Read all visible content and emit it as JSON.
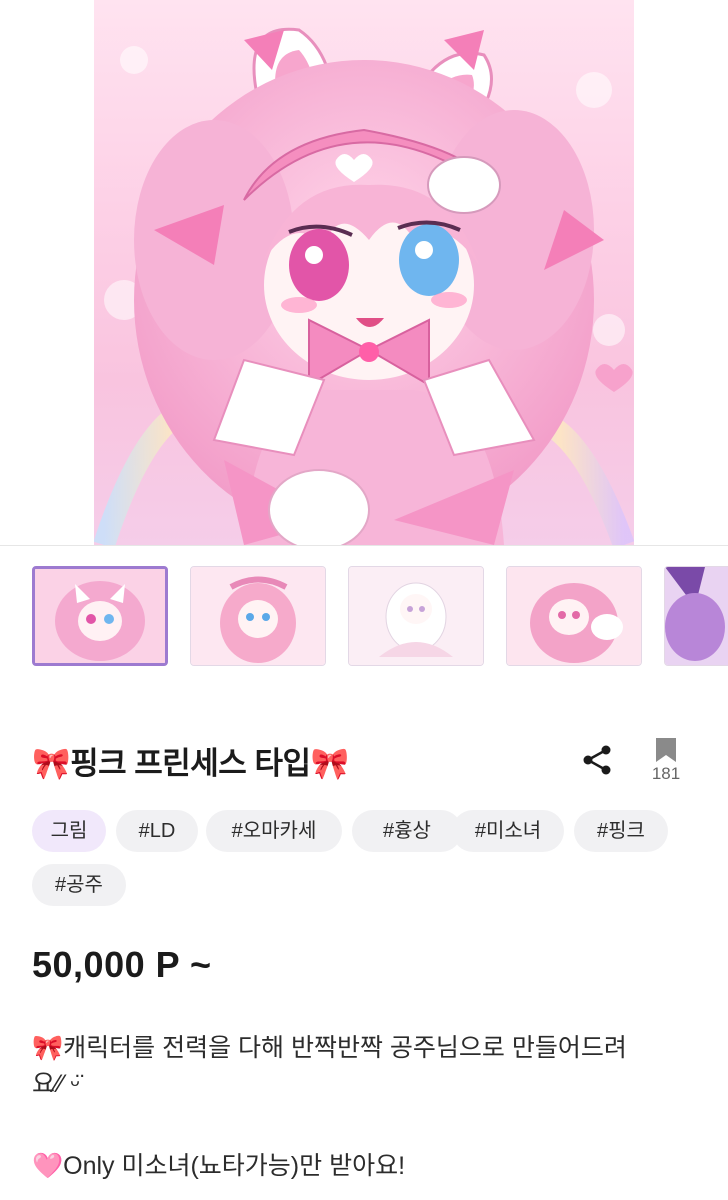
{
  "gallery": {
    "thumbnail_count": 5,
    "selected_index": 0
  },
  "product": {
    "title": "🎀핑크 프린세스 타입🎀",
    "bookmark_count": "181",
    "price": "50,000 P ~"
  },
  "tags": {
    "category": "그림",
    "items": [
      "#LD",
      "#오마카세",
      "#흉상",
      "#미소녀",
      "#핑크",
      "#공주"
    ]
  },
  "description": {
    "line1": "🎀캐릭터를 전력을 다해 반짝반짝 공주님으로 만들어드려",
    "line2": "요⁄⁄ ᵕ̈",
    "line3": "🩷Only 미소녀(뇨타가능)만 받아요!"
  },
  "colors": {
    "accent": "#9d7ad0",
    "category_tag_bg": "#f1e8fb",
    "tag_bg": "#f1f1f3",
    "art_pink": "#f7bcd9"
  },
  "icons": [
    "share-icon",
    "bookmark-icon"
  ]
}
